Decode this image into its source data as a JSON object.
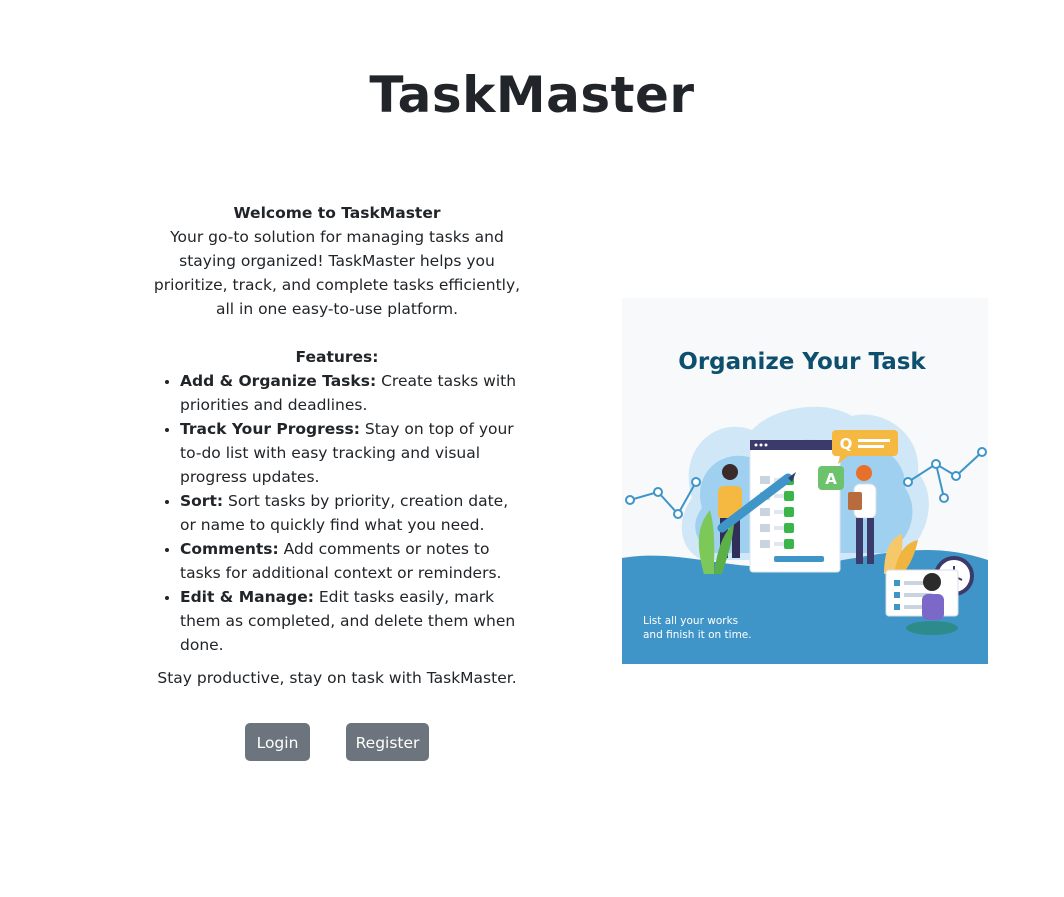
{
  "app_title": "TaskMaster",
  "intro": {
    "heading": "Welcome to TaskMaster",
    "text": "Your go-to solution for managing tasks and staying organized! TaskMaster helps you prioritize, track, and complete tasks efficiently, all in one easy-to-use platform."
  },
  "features": {
    "heading": "Features:",
    "items": [
      {
        "title": "Add & Organize Tasks:",
        "text": " Create tasks with priorities and deadlines."
      },
      {
        "title": "Track Your Progress:",
        "text": " Stay on top of your to-do list with easy tracking and visual progress updates."
      },
      {
        "title": "Sort:",
        "text": " Sort tasks by priority, creation date, or name to quickly find what you need."
      },
      {
        "title": "Comments:",
        "text": " Add comments or notes to tasks for additional context or reminders."
      },
      {
        "title": "Edit & Manage:",
        "text": " Edit tasks easily, mark them as completed, and delete them when done."
      }
    ]
  },
  "closing": "Stay productive, stay on task with TaskMaster.",
  "buttons": {
    "login": "Login",
    "register": "Register"
  },
  "illustration": {
    "title": "Organize Your Task",
    "caption_line1": "List all your works",
    "caption_line2": "and finish it on time.",
    "bubble_q": "Q",
    "bubble_a": "A"
  },
  "colors": {
    "button_bg": "#6c757d",
    "illustration_title": "#0e4f6e",
    "illustration_blue": "#3f95c8"
  }
}
